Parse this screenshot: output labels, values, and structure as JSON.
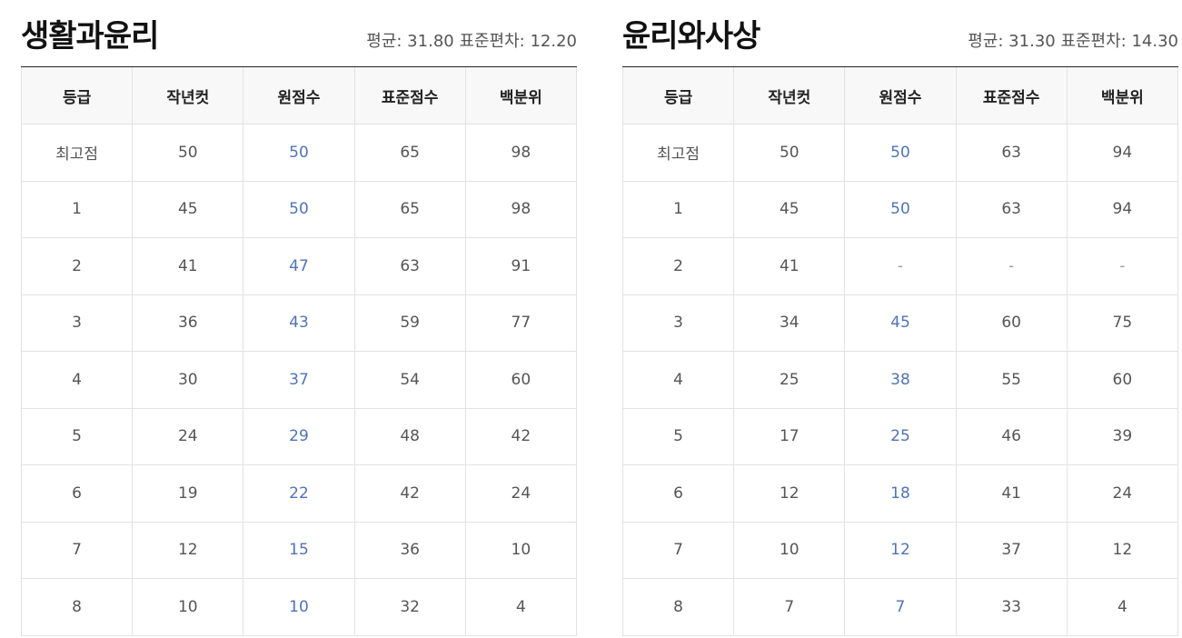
{
  "tables": [
    {
      "title": "생활과윤리",
      "stats": "평균: 31.80 표준편차: 12.20",
      "headers": [
        "등급",
        "작년컷",
        "원점수",
        "표준점수",
        "백분위"
      ],
      "rows": [
        [
          "최고점",
          "50",
          "50",
          "65",
          "98"
        ],
        [
          "1",
          "45",
          "50",
          "65",
          "98"
        ],
        [
          "2",
          "41",
          "47",
          "63",
          "91"
        ],
        [
          "3",
          "36",
          "43",
          "59",
          "77"
        ],
        [
          "4",
          "30",
          "37",
          "54",
          "60"
        ],
        [
          "5",
          "24",
          "29",
          "48",
          "42"
        ],
        [
          "6",
          "19",
          "22",
          "42",
          "24"
        ],
        [
          "7",
          "12",
          "15",
          "36",
          "10"
        ],
        [
          "8",
          "10",
          "10",
          "32",
          "4"
        ]
      ]
    },
    {
      "title": "윤리와사상",
      "stats": "평균: 31.30 표준편차: 14.30",
      "headers": [
        "등급",
        "작년컷",
        "원점수",
        "표준점수",
        "백분위"
      ],
      "rows": [
        [
          "최고점",
          "50",
          "50",
          "63",
          "94"
        ],
        [
          "1",
          "45",
          "50",
          "63",
          "94"
        ],
        [
          "2",
          "41",
          "-",
          "-",
          "-"
        ],
        [
          "3",
          "34",
          "45",
          "60",
          "75"
        ],
        [
          "4",
          "25",
          "38",
          "55",
          "60"
        ],
        [
          "5",
          "17",
          "25",
          "46",
          "39"
        ],
        [
          "6",
          "12",
          "18",
          "41",
          "24"
        ],
        [
          "7",
          "10",
          "12",
          "37",
          "12"
        ],
        [
          "8",
          "7",
          "7",
          "33",
          "4"
        ]
      ]
    }
  ],
  "colors": {
    "raw_score": "#4f73b8",
    "text": "#555555",
    "header_bg": "#f8f8f8",
    "border": "#e2e2e2"
  }
}
